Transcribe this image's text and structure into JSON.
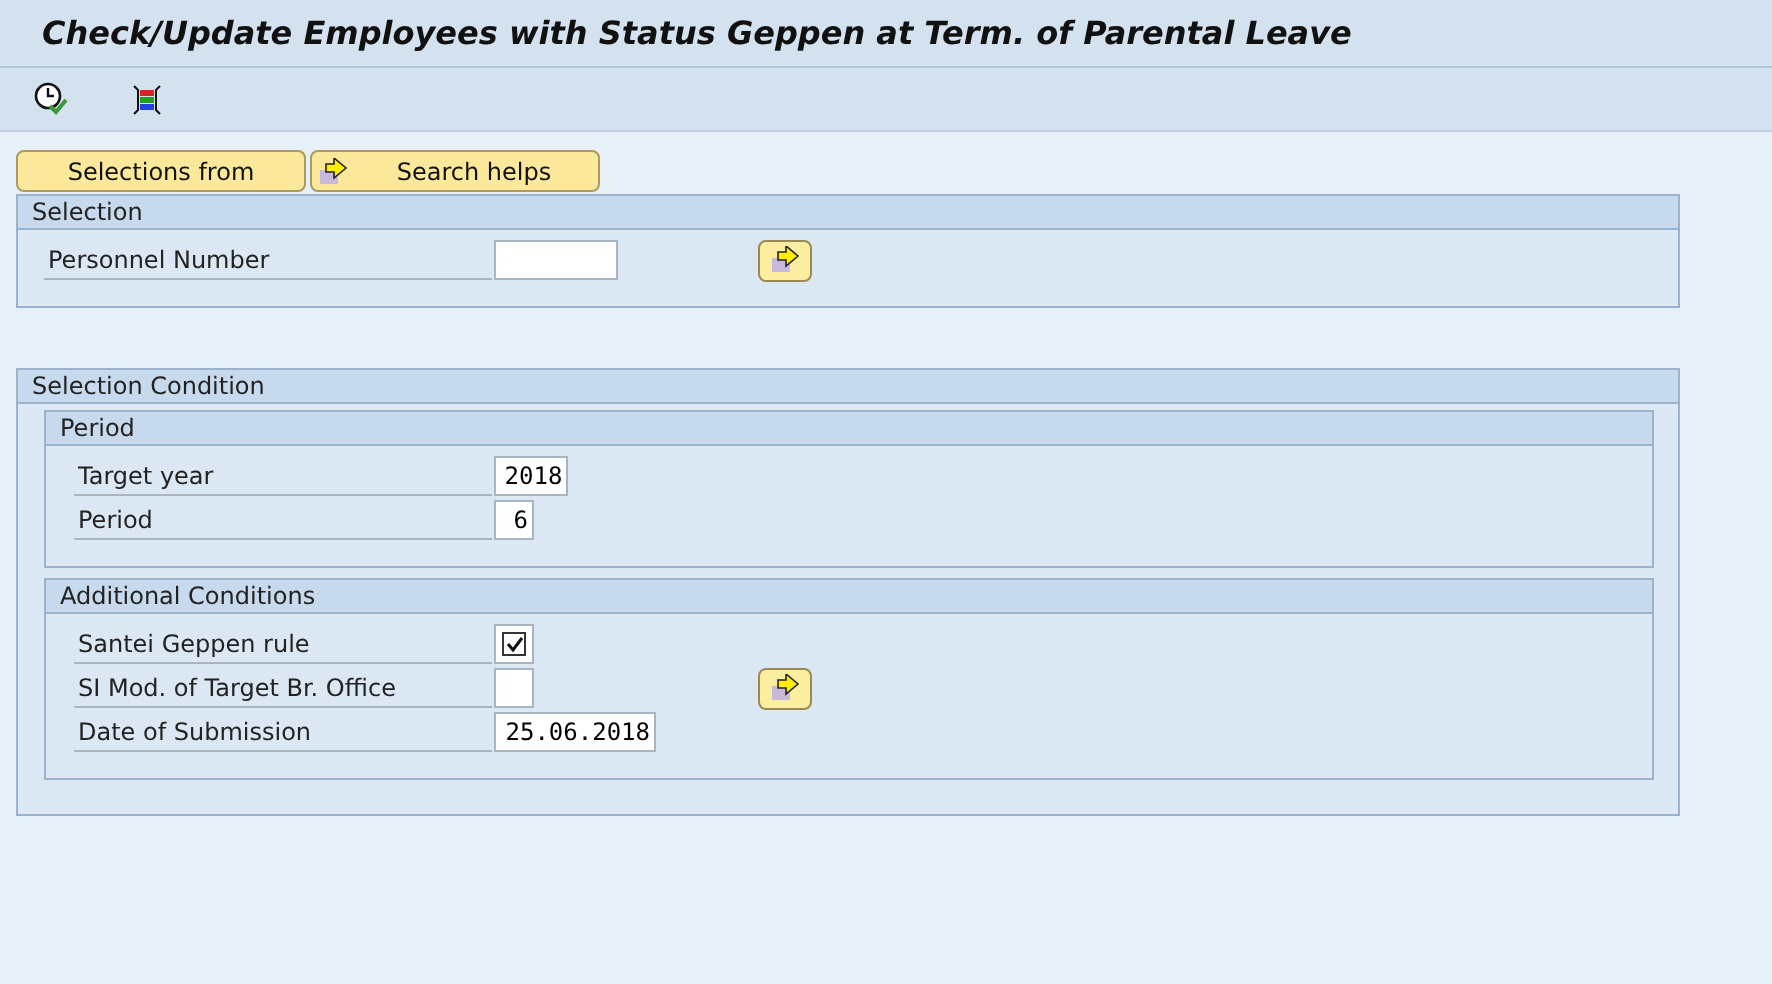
{
  "window": {
    "title": "Check/Update Employees with Status Geppen at Term. of Parental Leave"
  },
  "buttons": [
    {
      "label": "Selections from",
      "kind": "plain"
    },
    {
      "label": "Search helps",
      "kind": "arrow"
    }
  ],
  "blocks": [
    {
      "title": "Selection",
      "rows": [
        {
          "label": "Personnel Number",
          "kind": "input",
          "value": "",
          "multiple": true
        }
      ]
    },
    {
      "title": "Selection Condition",
      "groups": [
        {
          "title": "Period",
          "rows": [
            {
              "label": "Target year",
              "kind": "input",
              "value": "2018",
              "multiple": false
            },
            {
              "label": "Period",
              "kind": "input",
              "value": "6",
              "multiple": false
            }
          ]
        },
        {
          "title": "Additional Conditions",
          "rows": [
            {
              "label": "Santei Geppen rule",
              "kind": "checkbox",
              "checked": true,
              "multiple": false
            },
            {
              "label": "SI Mod. of Target Br. Office",
              "kind": "input",
              "value": "",
              "multiple": true
            },
            {
              "label": "Date of Submission",
              "kind": "input",
              "value": "25.06.2018",
              "multiple": false
            }
          ]
        }
      ]
    }
  ]
}
